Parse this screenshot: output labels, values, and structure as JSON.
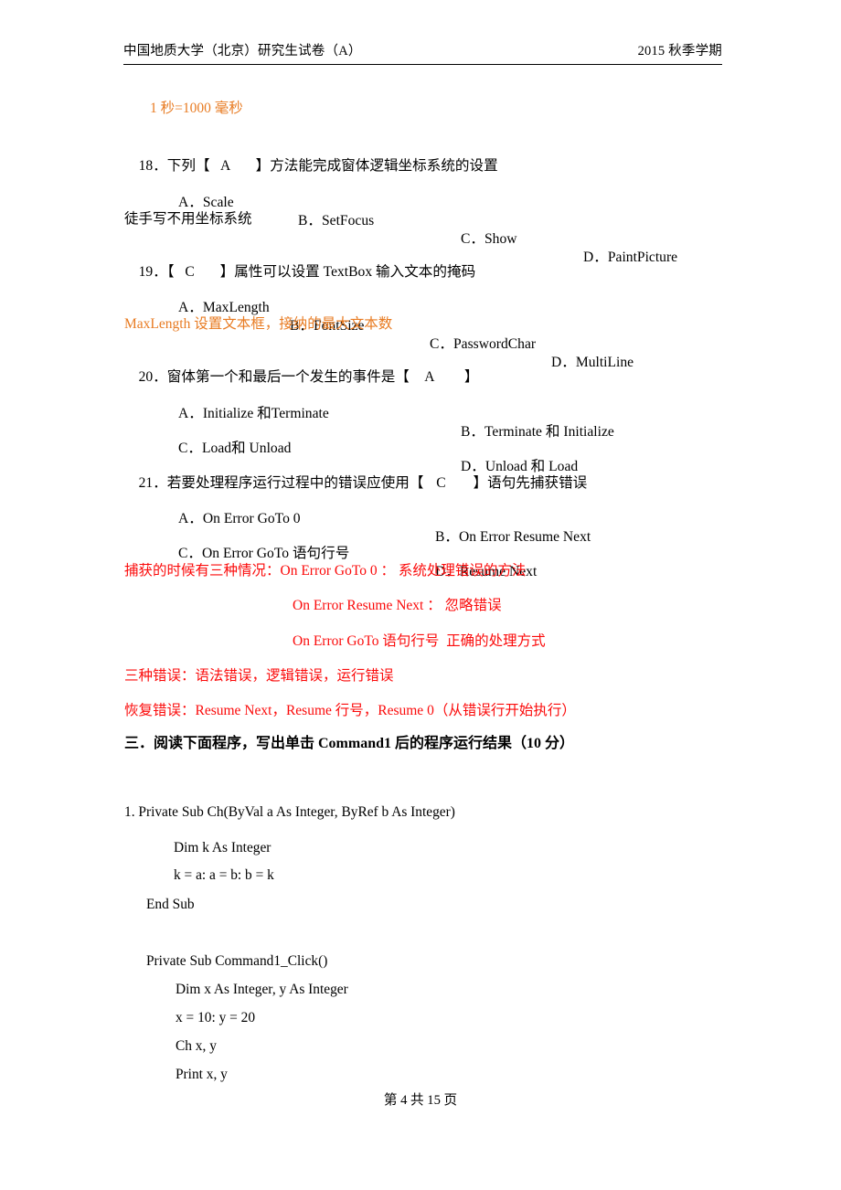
{
  "header": {
    "left": "中国地质大学（北京）研究生试卷（A）",
    "right": "2015 秋季学期"
  },
  "notes": {
    "second_millisecond": "1 秒=1000 毫秒",
    "freehand_no_coord": "徒手写不用坐标系统",
    "maxlength_note": "MaxLength 设置文本框，接纳的最大文本数",
    "catch_line1": "捕获的时候有三种情况：On Error GoTo 0 ： 系统处理错误的方法",
    "catch_line2": "On Error Resume Next ： 忽略错误",
    "catch_line3": "On Error GoTo 语句行号  正确的处理方式",
    "three_errors": "三种错误：语法错误，逻辑错误，运行错误",
    "recover_errors": "恢复错误：Resume Next，Resume 行号，Resume 0（从错误行开始执行）"
  },
  "questions": [
    {
      "number": "18．",
      "stem_before": "下列【",
      "answer": "A",
      "stem_after": "】方法能完成窗体逻辑坐标系统的设置",
      "options": [
        {
          "label": "A．",
          "text": "Scale"
        },
        {
          "label": "B．",
          "text": "SetFocus"
        },
        {
          "label": "C．",
          "text": "Show"
        },
        {
          "label": "D．",
          "text": "PaintPicture"
        }
      ]
    },
    {
      "number": "19．",
      "stem_before": "【",
      "answer": "C",
      "stem_after": "】属性可以设置 TextBox 输入文本的掩码",
      "options": [
        {
          "label": "A．",
          "text": "MaxLength"
        },
        {
          "label": "B．",
          "text": "FontSize"
        },
        {
          "label": "C．",
          "text": "PasswordChar"
        },
        {
          "label": "D．",
          "text": "MultiLine"
        }
      ]
    },
    {
      "number": "20．",
      "stem_before": "窗体第一个和最后一个发生的事件是【",
      "answer": "A",
      "stem_after": "】",
      "options": [
        {
          "label": "A．",
          "text": "Initialize 和Terminate"
        },
        {
          "label": "B．",
          "text": "Terminate 和 Initialize"
        },
        {
          "label": "C．",
          "text": "Load和 Unload"
        },
        {
          "label": "D．",
          "text": "Unload 和 Load"
        }
      ]
    },
    {
      "number": "21．",
      "stem_before": "若要处理程序运行过程中的错误应使用【",
      "answer": "C",
      "stem_after": "】语句先捕获错误",
      "options": [
        {
          "label": "A．",
          "text": "On Error GoTo 0"
        },
        {
          "label": "B．",
          "text": "On Error Resume Next"
        },
        {
          "label": "C．",
          "text": "On Error GoTo 语句行号"
        },
        {
          "label": "D．",
          "text": "Resume Next"
        }
      ]
    }
  ],
  "section_heading": "三．阅读下面程序，写出单击 Command1 后的程序运行结果（10 分）",
  "code_blocks": [
    {
      "lines": [
        "1. Private Sub Ch(ByVal a As Integer, ByRef b As Integer)",
        "Dim k As Integer",
        "k = a: a = b: b = k",
        "End Sub"
      ]
    },
    {
      "lines": [
        "Private Sub Command1_Click()",
        "Dim x As Integer, y As Integer",
        "x = 10: y = 20",
        "Ch x, y",
        "Print x, y"
      ]
    }
  ],
  "footer": "第 4 共 15 页",
  "colors": {
    "orange_note": "#E87B22",
    "red_note": "#FB0A0A",
    "text": "#000000"
  }
}
